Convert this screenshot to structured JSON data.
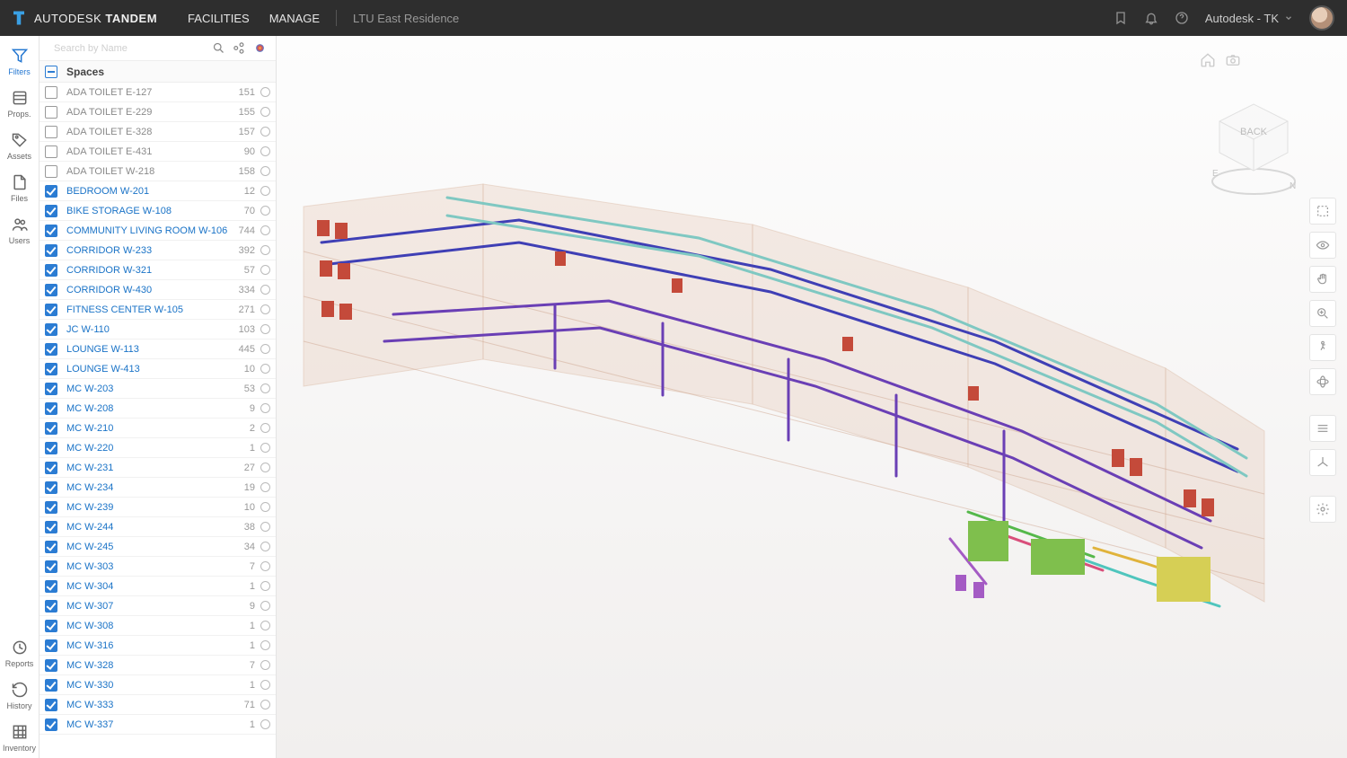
{
  "brand": {
    "autodesk": "AUTODESK",
    "product": "TANDEM"
  },
  "nav": {
    "facilities": "FACILITIES",
    "manage": "MANAGE"
  },
  "facility": "LTU East Residence",
  "account": "Autodesk - TK",
  "rail": {
    "filters": "Filters",
    "props": "Props.",
    "assets": "Assets",
    "files": "Files",
    "users": "Users",
    "reports": "Reports",
    "history": "History",
    "inventory": "Inventory"
  },
  "panel": {
    "search_hint": "Search by Name",
    "group_label": "Spaces"
  },
  "viewcube": {
    "face": "BACK"
  },
  "spaces": [
    {
      "label": "ADA TOILET E-127",
      "count": 151,
      "checked": false
    },
    {
      "label": "ADA TOILET E-229",
      "count": 155,
      "checked": false
    },
    {
      "label": "ADA TOILET E-328",
      "count": 157,
      "checked": false
    },
    {
      "label": "ADA TOILET E-431",
      "count": 90,
      "checked": false
    },
    {
      "label": "ADA TOILET W-218",
      "count": 158,
      "checked": false
    },
    {
      "label": "BEDROOM W-201",
      "count": 12,
      "checked": true
    },
    {
      "label": "BIKE STORAGE W-108",
      "count": 70,
      "checked": true
    },
    {
      "label": "COMMUNITY LIVING ROOM W-106",
      "count": 744,
      "checked": true
    },
    {
      "label": "CORRIDOR W-233",
      "count": 392,
      "checked": true
    },
    {
      "label": "CORRIDOR W-321",
      "count": 57,
      "checked": true
    },
    {
      "label": "CORRIDOR W-430",
      "count": 334,
      "checked": true
    },
    {
      "label": "FITNESS CENTER W-105",
      "count": 271,
      "checked": true
    },
    {
      "label": "JC W-110",
      "count": 103,
      "checked": true
    },
    {
      "label": "LOUNGE W-113",
      "count": 445,
      "checked": true
    },
    {
      "label": "LOUNGE W-413",
      "count": 10,
      "checked": true
    },
    {
      "label": "MC W-203",
      "count": 53,
      "checked": true
    },
    {
      "label": "MC W-208",
      "count": 9,
      "checked": true
    },
    {
      "label": "MC W-210",
      "count": 2,
      "checked": true
    },
    {
      "label": "MC W-220",
      "count": 1,
      "checked": true
    },
    {
      "label": "MC W-231",
      "count": 27,
      "checked": true
    },
    {
      "label": "MC W-234",
      "count": 19,
      "checked": true
    },
    {
      "label": "MC W-239",
      "count": 10,
      "checked": true
    },
    {
      "label": "MC W-244",
      "count": 38,
      "checked": true
    },
    {
      "label": "MC W-245",
      "count": 34,
      "checked": true
    },
    {
      "label": "MC W-303",
      "count": 7,
      "checked": true
    },
    {
      "label": "MC W-304",
      "count": 1,
      "checked": true
    },
    {
      "label": "MC W-307",
      "count": 9,
      "checked": true
    },
    {
      "label": "MC W-308",
      "count": 1,
      "checked": true
    },
    {
      "label": "MC W-316",
      "count": 1,
      "checked": true
    },
    {
      "label": "MC W-328",
      "count": 7,
      "checked": true
    },
    {
      "label": "MC W-330",
      "count": 1,
      "checked": true
    },
    {
      "label": "MC W-333",
      "count": 71,
      "checked": true
    },
    {
      "label": "MC W-337",
      "count": 1,
      "checked": true
    }
  ],
  "colors": {
    "accent": "#2b7cd3"
  }
}
